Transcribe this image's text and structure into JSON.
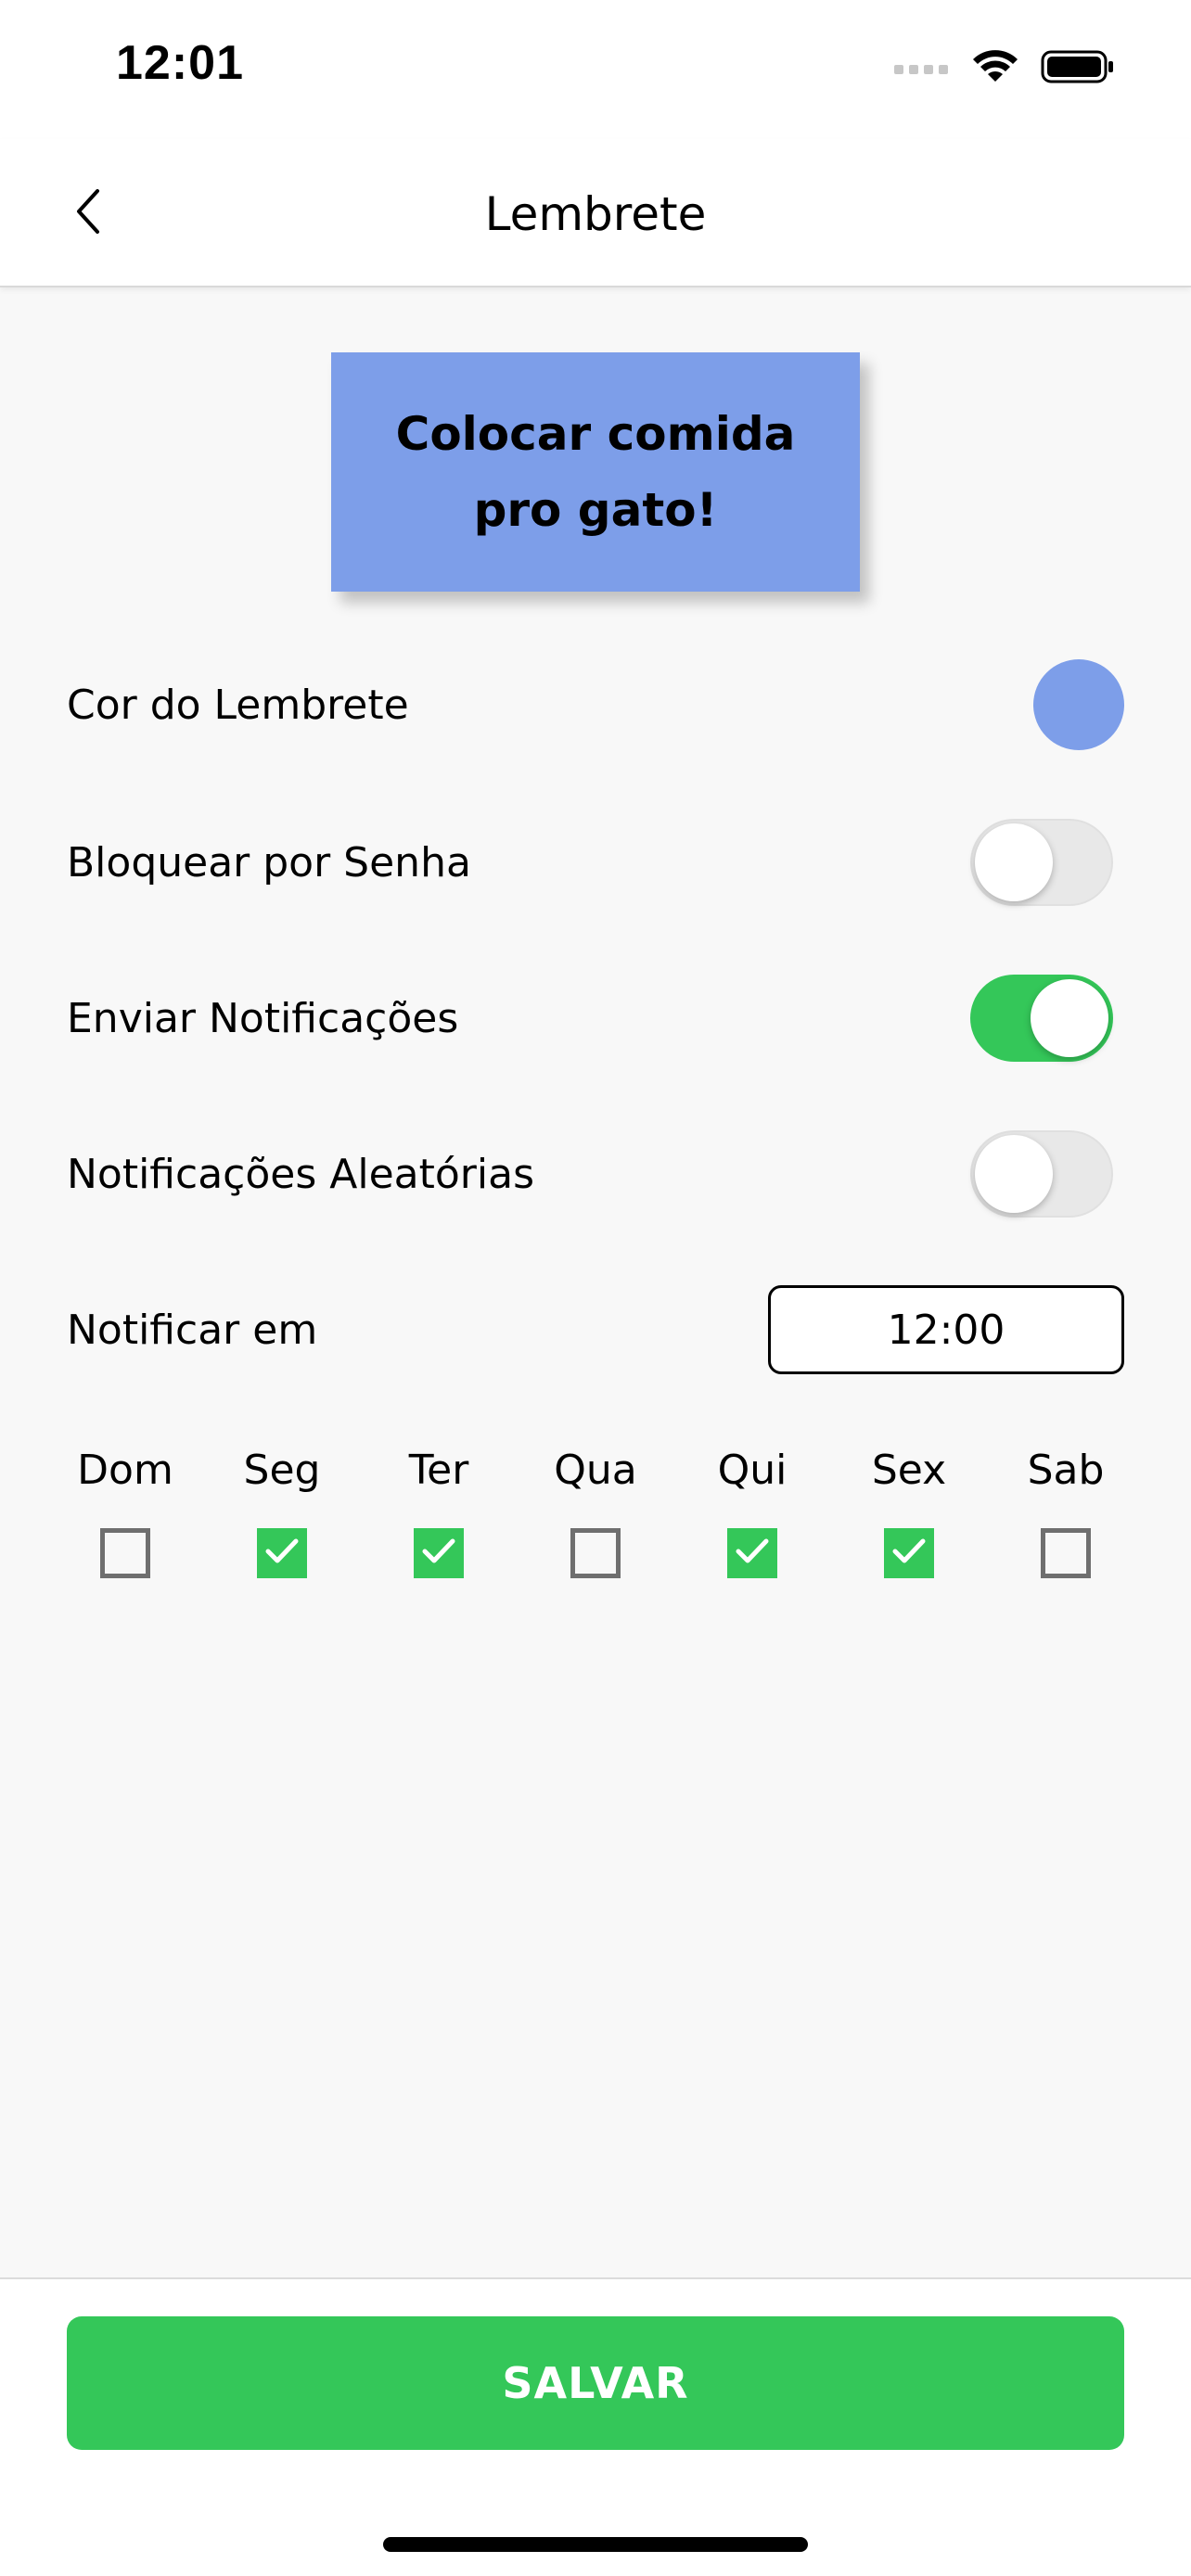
{
  "status_bar": {
    "time": "12:01",
    "icons": [
      "signal-icon",
      "wifi-icon",
      "battery-icon"
    ]
  },
  "nav": {
    "title": "Lembrete",
    "back_icon": "chevron-left-icon"
  },
  "note": {
    "line1": "Colocar comida",
    "line2": "pro gato!",
    "color": "#7d9ee9"
  },
  "settings": {
    "color_label": "Cor do Lembrete",
    "color_value": "#7d9ee9",
    "lock_label": "Bloquear por Senha",
    "lock_on": false,
    "notify_label": "Enviar Notificações",
    "notify_on": true,
    "random_label": "Notificações Aleatórias",
    "random_on": false,
    "time_label": "Notificar em",
    "time_value": "12:00"
  },
  "days": [
    {
      "label": "Dom",
      "checked": false
    },
    {
      "label": "Seg",
      "checked": true
    },
    {
      "label": "Ter",
      "checked": true
    },
    {
      "label": "Qua",
      "checked": false
    },
    {
      "label": "Qui",
      "checked": true
    },
    {
      "label": "Sex",
      "checked": true
    },
    {
      "label": "Sab",
      "checked": false
    }
  ],
  "footer": {
    "save_label": "SALVAR"
  },
  "colors": {
    "accent_green": "#34c759",
    "note_blue": "#7d9ee9"
  }
}
